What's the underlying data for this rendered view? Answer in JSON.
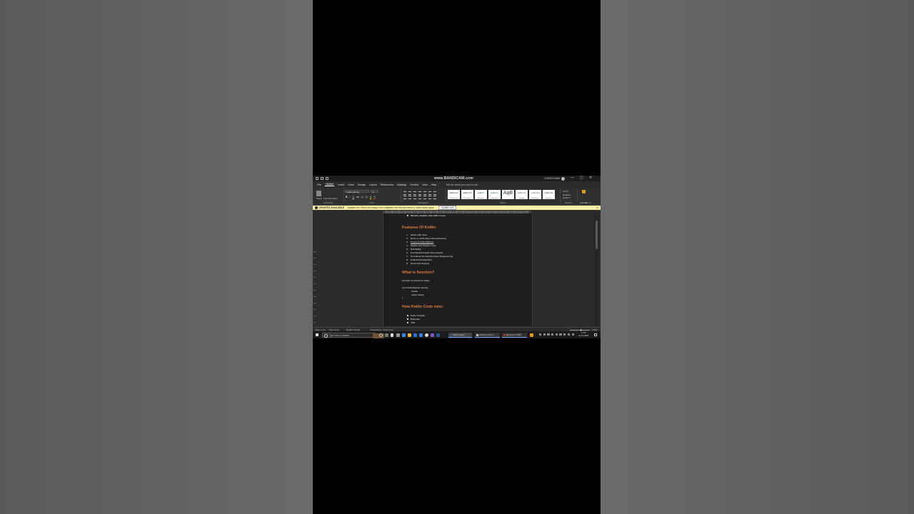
{
  "window": {
    "watermark": "www.BANDICAM.com",
    "user_name": "LIVEDS DAMI",
    "window_controls": [
      "—",
      "▢",
      "✕"
    ]
  },
  "menu": {
    "items": [
      "File",
      "Home",
      "Insert",
      "Draw",
      "Design",
      "Layout",
      "References",
      "Mailings",
      "Review",
      "View",
      "Help"
    ],
    "active": "Home",
    "tell_me": "Tell me what you want to do"
  },
  "ribbon": {
    "paste_label": "Paste",
    "format_painter": "Format Painter",
    "font_name": "Calibri (Body)",
    "font_size": "11",
    "format_buttons": [
      "B",
      "I",
      "U",
      "ab",
      "x₂",
      "x²",
      "A",
      "A"
    ],
    "styles": [
      {
        "preview": "AaBbCcDc",
        "name": "¶ Normal"
      },
      {
        "preview": "AaBbCcDc",
        "name": "¶ No Spac..."
      },
      {
        "preview": "AaBbCc",
        "name": "Heading 1"
      },
      {
        "preview": "AaBbCcC",
        "name": "Heading 2"
      },
      {
        "preview": "AaB",
        "name": "Title"
      },
      {
        "preview": "AaBbCcD",
        "name": "Subtitle"
      },
      {
        "preview": "AaBbCcDi",
        "name": "Subtle Em..."
      },
      {
        "preview": "AaBbCcDi",
        "name": "Emphasis"
      }
    ],
    "editing": [
      "Find ▾",
      "Replace",
      "Select ▾"
    ],
    "addins_label": "Add-ins",
    "group_labels": [
      "Clipboard",
      "Font",
      "Paragraph",
      "Styles",
      "Editing",
      "Add-ins"
    ]
  },
  "update_bar": {
    "title": "UPDATES AVAILABLE",
    "message": "Updates for Office are ready to be installed, but first we need to close some apps.",
    "button": "Update now",
    "close": "✕"
  },
  "document": {
    "top_bullet": "Shorter, cleaner, and safer to use",
    "heading1": "Features Of Kotlin:",
    "features": [
      {
        "num": "1.",
        "text": "Works with Java"
      },
      {
        "num": "2.",
        "text": "Runs on JVM (Java Virtual Machine)"
      },
      {
        "num": "3.",
        "text": "Supports Multi-Platform"
      },
      {
        "num": "4.",
        "text": "Shorter and Cleaner code"
      },
      {
        "num": "5.",
        "text": "Null Safety"
      },
      {
        "num": "6.",
        "text": "Functional Programming Support"
      },
      {
        "num": "7.",
        "text": "Coroutines for Asynchronous Programming"
      },
      {
        "num": "8.",
        "text": "Android Development"
      },
      {
        "num": "9.",
        "text": "Great Tool Support"
      }
    ],
    "heading2": "What is function?",
    "func_def": "Function is a block of codes.",
    "code": [
      "fun functionName( inouts){",
      "//Code",
      "return output",
      "}"
    ],
    "heading3": "How Kotlin Code runs:",
    "run_bullets": [
      "Kotlin compiler",
      "Bytecode",
      "JVM"
    ]
  },
  "status": {
    "page": "Page 1 of 1",
    "words": "136 words",
    "language": "English (India)",
    "accessibility": "Accessibility: Good to go",
    "zoom": "100%"
  },
  "taskbar": {
    "search_placeholder": "Type here to search",
    "apps": [
      {
        "label": "Kotlin Notes - ...",
        "color": "#2b5797"
      },
      {
        "label": "KotlinFunctions - ...",
        "color": "#dddddd"
      },
      {
        "label": "Bandicam 2025...",
        "color": "#c0392b"
      }
    ],
    "time": "17:56",
    "date": "21-01-2025"
  }
}
